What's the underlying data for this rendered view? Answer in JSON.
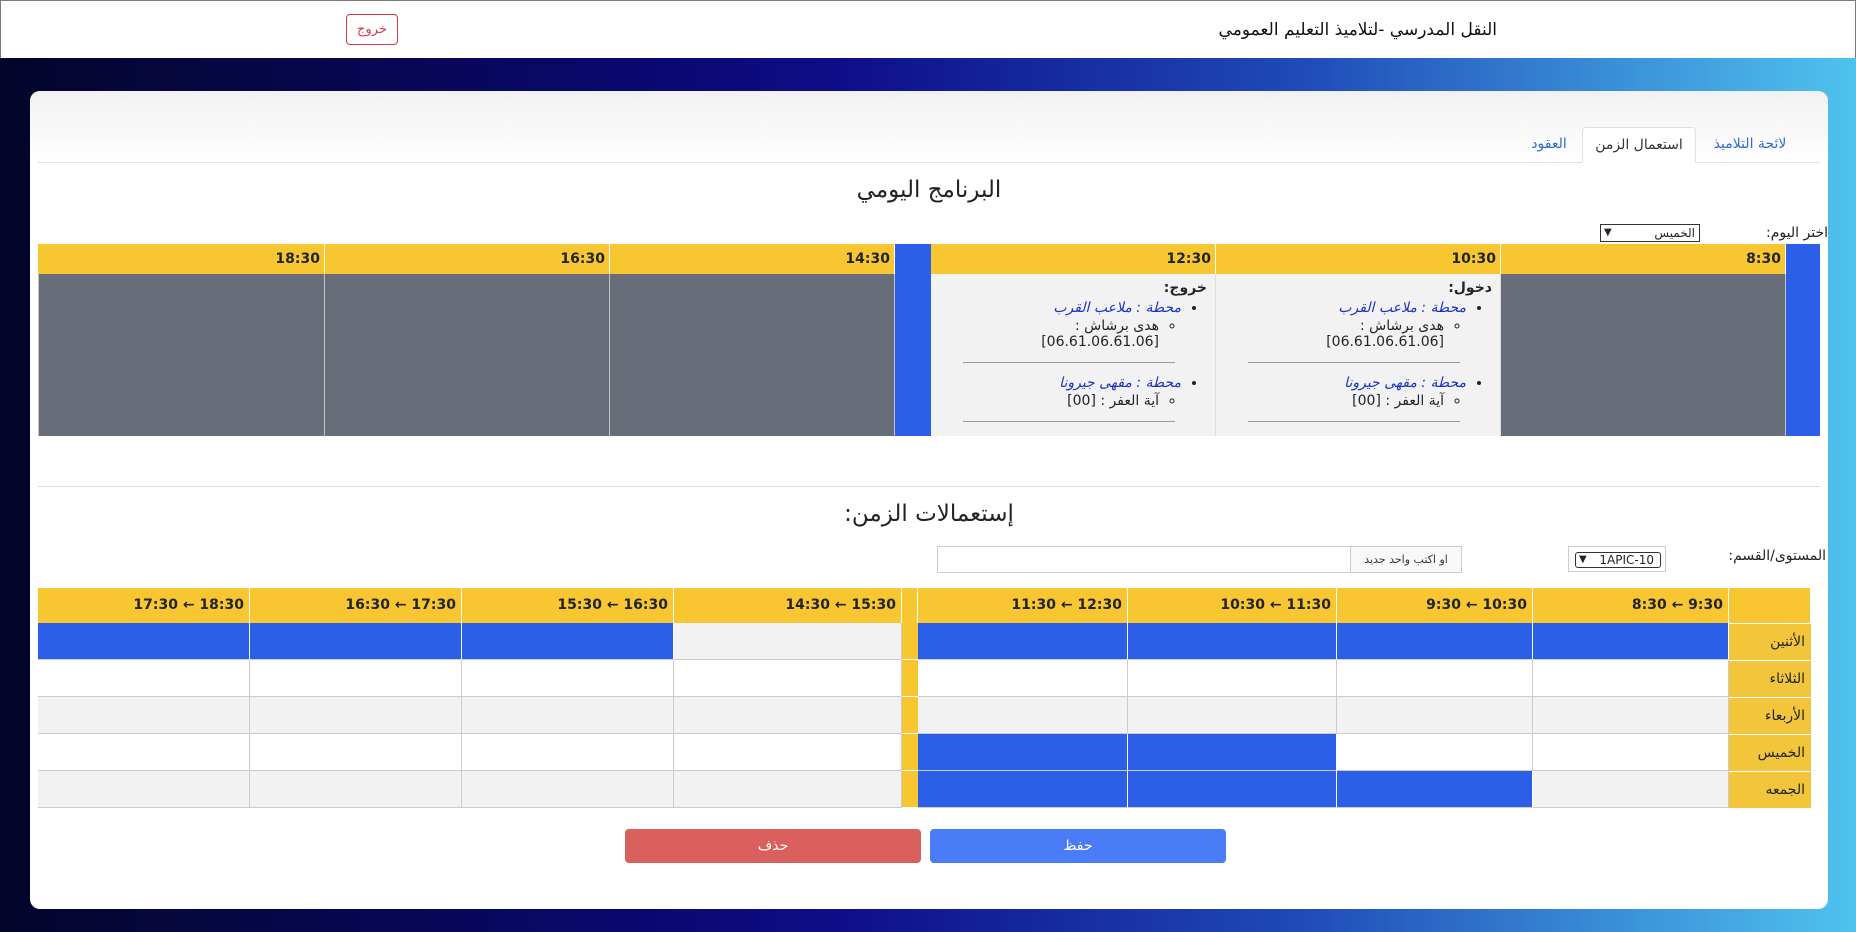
{
  "header": {
    "title": "النقل المدرسي -لتلاميذ التعليم العمومي",
    "logout_label": "خروج"
  },
  "tabs": [
    {
      "label": "لائحة التلاميذ",
      "active": false
    },
    {
      "label": "استعمال الزمن",
      "active": true
    },
    {
      "label": "العقود",
      "active": false
    }
  ],
  "daily": {
    "title": "البرنامج اليومي",
    "day_label": "اختر اليوم:",
    "day_value": "الخميس",
    "times": [
      "8:30",
      "10:30",
      "12:30",
      "14:30",
      "16:30",
      "18:30"
    ],
    "entry": {
      "kind": "دخول:",
      "stations": [
        {
          "station": "محطة : ملاعب القرب",
          "student": "هدى برشاش :",
          "phone": "[06.61.06.61.06]"
        },
        {
          "station": "محطة : مقهى جيرونا",
          "student": "آية العفر : [00]",
          "phone": ""
        }
      ]
    },
    "exit": {
      "kind": "خروج:",
      "stations": [
        {
          "station": "محطة : ملاعب القرب",
          "student": "هدى برشاش :",
          "phone": "[06.61.06.61.06]"
        },
        {
          "station": "محطة : مقهى جيرونا",
          "student": "آية العفر : [00]",
          "phone": ""
        }
      ]
    }
  },
  "timetables": {
    "title": "إستعمالات الزمن:",
    "level_label": "المستوى/القسم:",
    "level_value": "1APIC-10",
    "new_addon": "او اكتب واحد جديد",
    "new_value": "",
    "headers": [
      "8:30 ← 9:30",
      "9:30 ← 10:30",
      "10:30 ← 11:30",
      "11:30 ← 12:30",
      "14:30 ← 15:30",
      "15:30 ← 16:30",
      "16:30 ← 17:30",
      "17:30 ← 18:30"
    ],
    "rows": [
      {
        "day": "الأثنين",
        "cells": [
          "b",
          "b",
          "b",
          "b",
          "x",
          "b",
          "b",
          "b"
        ]
      },
      {
        "day": "الثلاثاء",
        "cells": [
          "x",
          "x",
          "x",
          "x",
          "x",
          "x",
          "x",
          "x"
        ]
      },
      {
        "day": "الأربعاء",
        "cells": [
          "x",
          "x",
          "x",
          "x",
          "x",
          "x",
          "x",
          "x"
        ]
      },
      {
        "day": "الخميس",
        "cells": [
          "x",
          "x",
          "b",
          "b",
          "x",
          "x",
          "x",
          "x"
        ]
      },
      {
        "day": "الجمعه",
        "cells": [
          "x",
          "b",
          "b",
          "b",
          "x",
          "x",
          "x",
          "x"
        ]
      }
    ]
  },
  "actions": {
    "save": "حفظ",
    "delete": "حذف"
  },
  "colors": {
    "accent_blue": "#2c5fe8",
    "header_yellow": "#f8c630",
    "danger": "#d9605c",
    "primary": "#4a7cf7"
  }
}
